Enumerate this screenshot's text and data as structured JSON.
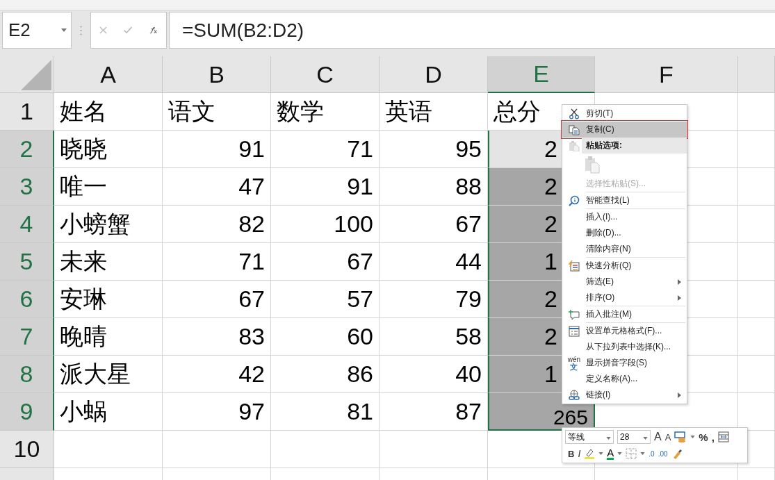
{
  "formula_bar": {
    "name_box": "E2",
    "formula": "=SUM(B2:D2)"
  },
  "columns": [
    {
      "label": "A",
      "selected": false
    },
    {
      "label": "B",
      "selected": false
    },
    {
      "label": "C",
      "selected": false
    },
    {
      "label": "D",
      "selected": false
    },
    {
      "label": "E",
      "selected": true
    },
    {
      "label": "F",
      "selected": false
    }
  ],
  "rows": [
    {
      "header": "1",
      "selected": false,
      "cells": [
        {
          "text": "姓名",
          "kind": "text",
          "selected": false
        },
        {
          "text": "语文",
          "kind": "text",
          "selected": false
        },
        {
          "text": "数学",
          "kind": "text",
          "selected": false
        },
        {
          "text": "英语",
          "kind": "text",
          "selected": false
        },
        {
          "text": "总分",
          "kind": "text",
          "selected": false
        }
      ]
    },
    {
      "header": "2",
      "selected": true,
      "cells": [
        {
          "text": "晓晓",
          "kind": "text",
          "selected": false
        },
        {
          "text": "91",
          "kind": "number",
          "selected": false
        },
        {
          "text": "71",
          "kind": "number",
          "selected": false
        },
        {
          "text": "95",
          "kind": "number",
          "selected": false
        },
        {
          "text": "2",
          "kind": "cut",
          "selected": true,
          "active": true
        }
      ]
    },
    {
      "header": "3",
      "selected": true,
      "cells": [
        {
          "text": "唯一",
          "kind": "text",
          "selected": false
        },
        {
          "text": "47",
          "kind": "number",
          "selected": false
        },
        {
          "text": "91",
          "kind": "number",
          "selected": false
        },
        {
          "text": "88",
          "kind": "number",
          "selected": false
        },
        {
          "text": "2",
          "kind": "cut",
          "selected": true,
          "active": false
        }
      ]
    },
    {
      "header": "4",
      "selected": true,
      "cells": [
        {
          "text": "小螃蟹",
          "kind": "text",
          "selected": false
        },
        {
          "text": "82",
          "kind": "number",
          "selected": false
        },
        {
          "text": "100",
          "kind": "number",
          "selected": false
        },
        {
          "text": "67",
          "kind": "number",
          "selected": false
        },
        {
          "text": "2",
          "kind": "cut",
          "selected": true,
          "active": false
        }
      ]
    },
    {
      "header": "5",
      "selected": true,
      "cells": [
        {
          "text": "未来",
          "kind": "text",
          "selected": false
        },
        {
          "text": "71",
          "kind": "number",
          "selected": false
        },
        {
          "text": "67",
          "kind": "number",
          "selected": false
        },
        {
          "text": "44",
          "kind": "number",
          "selected": false
        },
        {
          "text": "1",
          "kind": "cut",
          "selected": true,
          "active": false
        }
      ]
    },
    {
      "header": "6",
      "selected": true,
      "cells": [
        {
          "text": "安琳",
          "kind": "text",
          "selected": false
        },
        {
          "text": "67",
          "kind": "number",
          "selected": false
        },
        {
          "text": "57",
          "kind": "number",
          "selected": false
        },
        {
          "text": "79",
          "kind": "number",
          "selected": false
        },
        {
          "text": "2",
          "kind": "cut",
          "selected": true,
          "active": false
        }
      ]
    },
    {
      "header": "7",
      "selected": true,
      "cells": [
        {
          "text": "晚晴",
          "kind": "text",
          "selected": false
        },
        {
          "text": "83",
          "kind": "number",
          "selected": false
        },
        {
          "text": "60",
          "kind": "number",
          "selected": false
        },
        {
          "text": "58",
          "kind": "number",
          "selected": false
        },
        {
          "text": "2",
          "kind": "cut",
          "selected": true,
          "active": false
        }
      ]
    },
    {
      "header": "8",
      "selected": true,
      "cells": [
        {
          "text": "派大星",
          "kind": "text",
          "selected": false
        },
        {
          "text": "42",
          "kind": "number",
          "selected": false
        },
        {
          "text": "86",
          "kind": "number",
          "selected": false
        },
        {
          "text": "40",
          "kind": "number",
          "selected": false
        },
        {
          "text": "1",
          "kind": "cut",
          "selected": true,
          "active": false
        }
      ]
    },
    {
      "header": "9",
      "selected": true,
      "cells": [
        {
          "text": "小蜗",
          "kind": "text",
          "selected": false
        },
        {
          "text": "97",
          "kind": "number",
          "selected": false
        },
        {
          "text": "81",
          "kind": "number",
          "selected": false
        },
        {
          "text": "87",
          "kind": "number",
          "selected": false
        },
        {
          "text": "265",
          "kind": "number",
          "selected": true,
          "active": false
        }
      ]
    },
    {
      "header": "10",
      "selected": false,
      "cells": []
    }
  ],
  "context_menu": [
    {
      "kind": "item",
      "label": "剪切(T)",
      "disabled": false,
      "highlighted": false,
      "submenu": false
    },
    {
      "kind": "item",
      "label": "复制(C)",
      "disabled": false,
      "highlighted": true,
      "submenu": false
    },
    {
      "kind": "header",
      "label": "粘贴选项:"
    },
    {
      "kind": "paste-icons"
    },
    {
      "kind": "item",
      "label": "选择性粘贴(S)...",
      "disabled": true,
      "highlighted": false,
      "submenu": false
    },
    {
      "kind": "separator"
    },
    {
      "kind": "item",
      "label": "智能查找(L)",
      "disabled": false,
      "highlighted": false,
      "submenu": false
    },
    {
      "kind": "separator"
    },
    {
      "kind": "item",
      "label": "插入(I)...",
      "disabled": false,
      "highlighted": false,
      "submenu": false
    },
    {
      "kind": "item",
      "label": "删除(D)...",
      "disabled": false,
      "highlighted": false,
      "submenu": false
    },
    {
      "kind": "item",
      "label": "清除内容(N)",
      "disabled": false,
      "highlighted": false,
      "submenu": false
    },
    {
      "kind": "separator"
    },
    {
      "kind": "item",
      "label": "快速分析(Q)",
      "disabled": false,
      "highlighted": false,
      "submenu": false
    },
    {
      "kind": "item",
      "label": "筛选(E)",
      "disabled": false,
      "highlighted": false,
      "submenu": true
    },
    {
      "kind": "item",
      "label": "排序(O)",
      "disabled": false,
      "highlighted": false,
      "submenu": true
    },
    {
      "kind": "separator"
    },
    {
      "kind": "item",
      "label": "插入批注(M)",
      "disabled": false,
      "highlighted": false,
      "submenu": false
    },
    {
      "kind": "separator"
    },
    {
      "kind": "item",
      "label": "设置单元格格式(F)...",
      "disabled": false,
      "highlighted": false,
      "submenu": false
    },
    {
      "kind": "item",
      "label": "从下拉列表中选择(K)...",
      "disabled": false,
      "highlighted": false,
      "submenu": false
    },
    {
      "kind": "item",
      "label": "显示拼音字段(S)",
      "icon_glyphs": [
        "wén",
        "文"
      ],
      "disabled": false,
      "highlighted": false,
      "submenu": false
    },
    {
      "kind": "item",
      "label": "定义名称(A)...",
      "disabled": false,
      "highlighted": false,
      "submenu": false
    },
    {
      "kind": "item",
      "label": "链接(I)",
      "disabled": false,
      "highlighted": false,
      "submenu": true
    }
  ],
  "mini_toolbar": {
    "font": "等线",
    "size": "28",
    "grow": "A",
    "shrink": "A",
    "percent": "%",
    "comma": ",",
    "bold": "B",
    "italic": "I",
    "font_color": "A",
    "increase_decimal": ".0",
    "decrease_decimal": ".00"
  }
}
